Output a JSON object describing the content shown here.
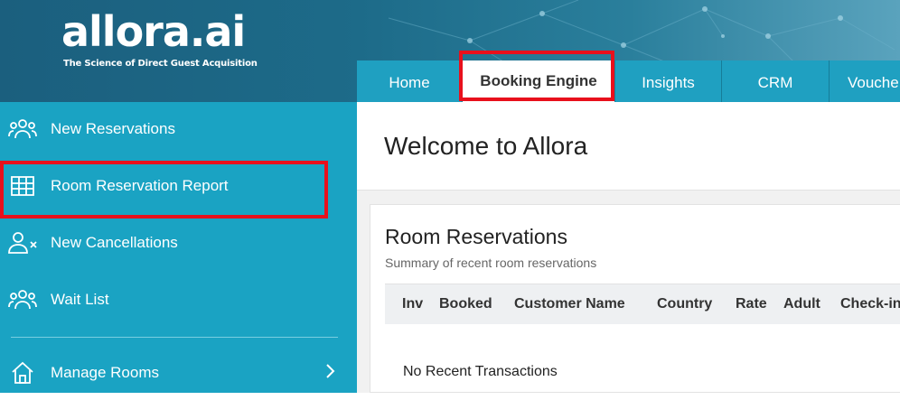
{
  "brand": {
    "logo": "allora.ai",
    "tagline": "The Science of Direct Guest Acquisition"
  },
  "tabs": [
    {
      "label": "Home",
      "active": false
    },
    {
      "label": "Booking Engine",
      "active": true
    },
    {
      "label": "Insights",
      "active": false
    },
    {
      "label": "CRM",
      "active": false
    },
    {
      "label": "Vouche",
      "active": false
    }
  ],
  "sidebar": {
    "items": [
      {
        "label": "New Reservations",
        "icon": "users-icon",
        "highlighted": false
      },
      {
        "label": "Room Reservation Report",
        "icon": "grid-table-icon",
        "highlighted": true
      },
      {
        "label": "New Cancellations",
        "icon": "user-remove-icon",
        "highlighted": false
      },
      {
        "label": "Wait List",
        "icon": "users-icon",
        "highlighted": false
      },
      {
        "label": "Manage Rooms",
        "icon": "home-icon",
        "highlighted": false,
        "has_submenu": true
      }
    ]
  },
  "main": {
    "welcome": "Welcome to Allora",
    "card": {
      "title": "Room Reservations",
      "subtitle": "Summary of recent room reservations",
      "columns": [
        "Inv",
        "Booked",
        "Customer Name",
        "Country",
        "Rate",
        "Adult",
        "Check-in"
      ],
      "empty_message": "No Recent Transactions"
    }
  },
  "colors": {
    "header": "#1d6b89",
    "sidebar": "#1aa3c3",
    "tabbar": "#1fa0c1",
    "highlight": "#e8101c"
  }
}
